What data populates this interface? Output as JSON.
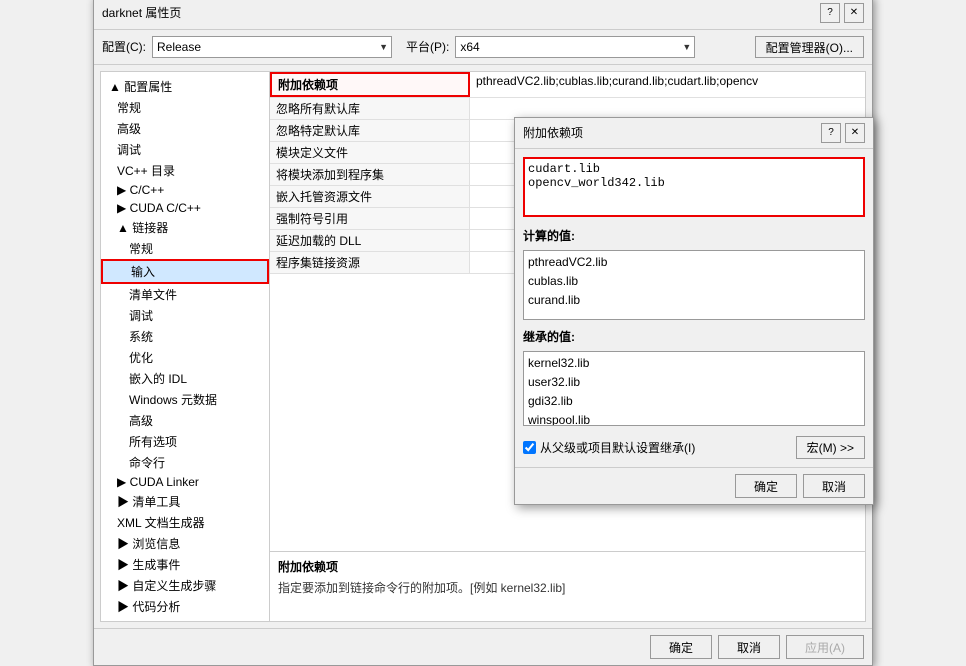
{
  "mainDialog": {
    "title": "darknet 属性页",
    "helpBtn": "?",
    "closeBtn": "✕"
  },
  "configBar": {
    "configLabel": "配置(C):",
    "configValue": "Release",
    "platformLabel": "平台(P):",
    "platformValue": "x64",
    "managerBtn": "配置管理器(O)..."
  },
  "tree": {
    "items": [
      {
        "label": "▲ 配置属性",
        "level": 0,
        "expand": true
      },
      {
        "label": "常规",
        "level": 1
      },
      {
        "label": "高级",
        "level": 1
      },
      {
        "label": "调试",
        "level": 1
      },
      {
        "label": "VC++ 目录",
        "level": 1
      },
      {
        "label": "▶ C/C++",
        "level": 1
      },
      {
        "label": "▶ CUDA C/C++",
        "level": 1
      },
      {
        "label": "▲ 链接器",
        "level": 1,
        "expand": true
      },
      {
        "label": "常规",
        "level": 2
      },
      {
        "label": "输入",
        "level": 2,
        "selected": true
      },
      {
        "label": "清单文件",
        "level": 2
      },
      {
        "label": "调试",
        "level": 2
      },
      {
        "label": "系统",
        "level": 2
      },
      {
        "label": "优化",
        "level": 2
      },
      {
        "label": "嵌入的 IDL",
        "level": 2
      },
      {
        "label": "Windows 元数据",
        "level": 2
      },
      {
        "label": "高级",
        "level": 2
      },
      {
        "label": "所有选项",
        "level": 2
      },
      {
        "label": "命令行",
        "level": 2
      },
      {
        "label": "▶ CUDA Linker",
        "level": 1
      },
      {
        "label": "▶ 清单工具",
        "level": 1
      },
      {
        "label": "XML 文档生成器",
        "level": 1
      },
      {
        "label": "▶ 浏览信息",
        "level": 1
      },
      {
        "label": "▶ 生成事件",
        "level": 1
      },
      {
        "label": "▶ 自定义生成步骤",
        "level": 1
      },
      {
        "label": "▶ 代码分析",
        "level": 1
      }
    ]
  },
  "properties": {
    "rows": [
      {
        "name": "附加依赖项",
        "value": "pthreadVC2.lib;cublas.lib;curand.lib;cudart.lib;opencv",
        "highlighted": true
      },
      {
        "name": "忽略所有默认库",
        "value": ""
      },
      {
        "name": "忽略特定默认库",
        "value": ""
      },
      {
        "name": "模块定义文件",
        "value": ""
      },
      {
        "name": "将模块添加到程序集",
        "value": ""
      },
      {
        "name": "嵌入托管资源文件",
        "value": ""
      },
      {
        "name": "强制符号引用",
        "value": ""
      },
      {
        "name": "延迟加载的 DLL",
        "value": ""
      },
      {
        "name": "程序集链接资源",
        "value": ""
      }
    ]
  },
  "description": {
    "title": "附加依赖项",
    "text": "指定要添加到链接命令行的附加项。[例如 kernel32.lib]"
  },
  "footer": {
    "okBtn": "确定",
    "cancelBtn": "取消",
    "applyBtn": "应用(A)"
  },
  "subDialog": {
    "title": "附加依赖项",
    "helpBtn": "?",
    "closeBtn": "✕",
    "editContent": "cudart.lib\nopencv_world342.lib",
    "editHighlightedLine": "opencv_world342.lib",
    "computedLabel": "计算的值:",
    "computedItems": [
      "pthreadVC2.lib",
      "cublas.lib",
      "curand.lib"
    ],
    "inheritedLabel": "继承的值:",
    "inheritedItems": [
      "kernel32.lib",
      "user32.lib",
      "gdi32.lib",
      "winspool.lib"
    ],
    "checkboxLabel": "从父级或项目默认设置继承(I)",
    "macroBtn": "宏(M) >>",
    "okBtn": "确定",
    "cancelBtn": "取消"
  }
}
